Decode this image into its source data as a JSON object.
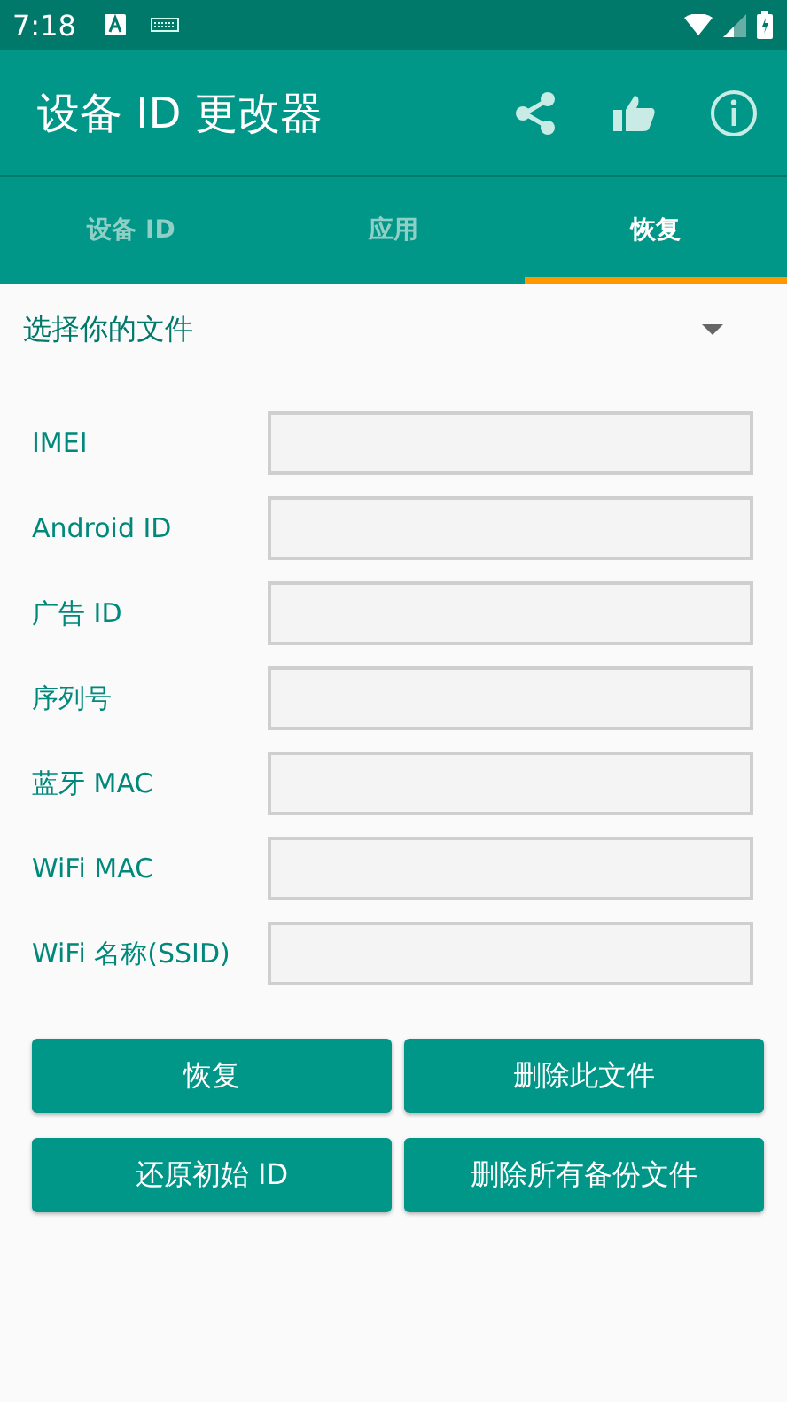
{
  "status_bar": {
    "time": "7:18"
  },
  "toolbar": {
    "title": "设备 ID 更改器"
  },
  "tabs": [
    {
      "label": "设备 ID",
      "selected": false
    },
    {
      "label": "应用",
      "selected": false
    },
    {
      "label": "恢复",
      "selected": true
    }
  ],
  "file_picker": {
    "value": "选择你的文件"
  },
  "fields": [
    {
      "label": "IMEI"
    },
    {
      "label": "Android ID"
    },
    {
      "label": "广告 ID"
    },
    {
      "label": "序列号"
    },
    {
      "label": "蓝牙 MAC"
    },
    {
      "label": "WiFi MAC"
    },
    {
      "label": "WiFi 名称(SSID)"
    }
  ],
  "buttons": [
    "恢复",
    "删除此文件",
    "还原初始 ID",
    "删除所有备份文件"
  ]
}
